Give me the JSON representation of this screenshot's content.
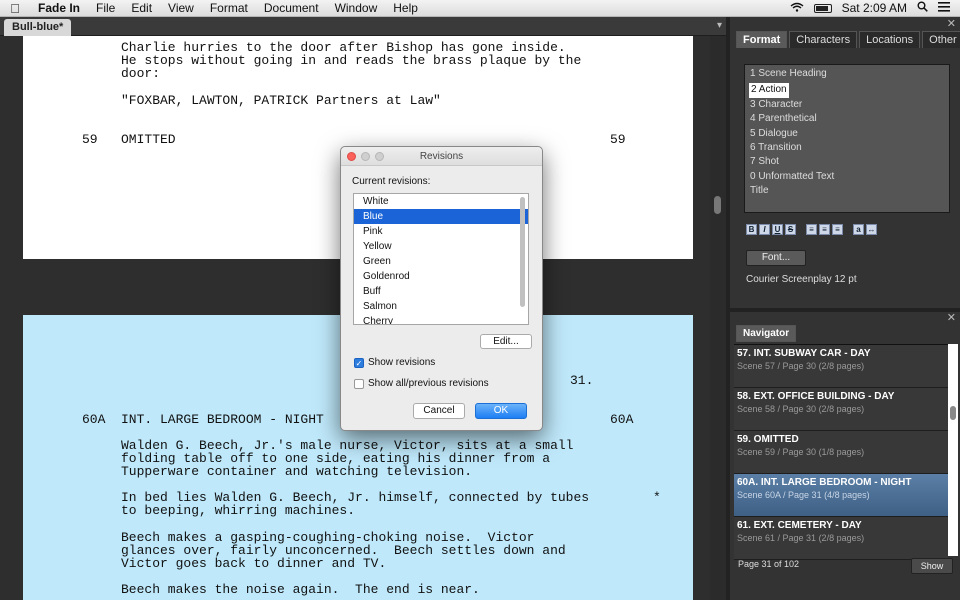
{
  "menubar": {
    "app_name": "Fade In",
    "items": [
      "File",
      "Edit",
      "View",
      "Format",
      "Document",
      "Window",
      "Help"
    ],
    "clock": "Sat 2:09 AM"
  },
  "tab": {
    "title": "Bull-blue*"
  },
  "script": {
    "page1_lines": [
      "Charlie hurries to the door after Bishop has gone inside.",
      "He stops without going in and reads the brass plaque by the",
      "door:",
      "\"FOXBAR, LAWTON, PATRICK Partners at Law\""
    ],
    "scene59": {
      "number": "59",
      "heading": "OMITTED"
    },
    "page_number": "31.",
    "scene60A": {
      "number": "60A",
      "heading": "INT. LARGE BEDROOM - NIGHT"
    },
    "page2_lines": [
      "Walden G. Beech, Jr.'s male nurse, Victor, sits at a small",
      "folding table off to one side, eating his dinner from a",
      "Tupperware container and watching television.",
      "In bed lies Walden G. Beech, Jr. himself, connected by tubes",
      "to beeping, whirring machines.",
      "Beech makes a gasping-coughing-choking noise.  Victor",
      "glances over, fairly unconcerned.  Beech settles down and",
      "Victor goes back to dinner and TV.",
      "Beech makes the noise again.  The end is near."
    ],
    "revision_mark": "*"
  },
  "format_panel": {
    "tabs": [
      "Format",
      "Characters",
      "Locations",
      "Other"
    ],
    "active_tab": "Format",
    "elements": [
      "1 Scene Heading",
      "2 Action",
      "3 Character",
      "4 Parenthetical",
      "5 Dialogue",
      "6 Transition",
      "7 Shot",
      "0 Unformatted Text",
      "Title"
    ],
    "selected_index": 1,
    "font_button": "Font...",
    "font_info": "Courier Screenplay 12 pt"
  },
  "navigator": {
    "tab": "Navigator",
    "scenes": [
      {
        "title": "57. INT. SUBWAY CAR - DAY",
        "sub": "Scene 57 / Page 30 (2/8 pages)"
      },
      {
        "title": "58. EXT. OFFICE BUILDING - DAY",
        "sub": "Scene 58 / Page 30 (2/8 pages)"
      },
      {
        "title": "59. OMITTED",
        "sub": "Scene 59 / Page 30 (1/8 pages)"
      },
      {
        "title": "60A. INT. LARGE BEDROOM - NIGHT",
        "sub": "Scene 60A / Page 31 (4/8 pages)"
      },
      {
        "title": "61. EXT. CEMETERY - DAY",
        "sub": "Scene 61 / Page 31 (2/8 pages)"
      }
    ],
    "selected_index": 3,
    "page_count": "Page 31 of 102",
    "show_button": "Show"
  },
  "dialog": {
    "title": "Revisions",
    "label": "Current revisions:",
    "revisions": [
      "White",
      "Blue",
      "Pink",
      "Yellow",
      "Green",
      "Goldenrod",
      "Buff",
      "Salmon",
      "Cherry"
    ],
    "selected_index": 1,
    "edit_button": "Edit...",
    "show_revisions": {
      "label": "Show revisions",
      "checked": true
    },
    "show_all": {
      "label": "Show all/previous revisions",
      "checked": false
    },
    "cancel": "Cancel",
    "ok": "OK"
  }
}
